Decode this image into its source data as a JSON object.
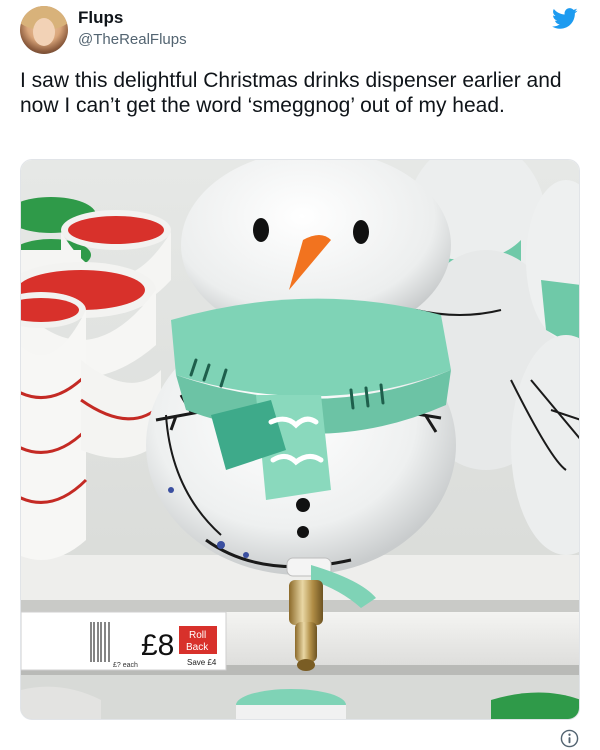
{
  "tweet": {
    "display_name": "Flups",
    "handle": "@TheRealFlups",
    "text": "I saw this delightful Christmas drinks dispenser earlier and now I can’t get the word ‘smeggnog’ out of my head.",
    "platform_icon": "twitter-bird-icon",
    "info_icon": "info-icon"
  },
  "photo": {
    "price_label": {
      "price": "£8",
      "each": "£? each",
      "badge_line1": "Roll",
      "badge_line2": "Back",
      "save": "Save £4"
    }
  },
  "colors": {
    "twitter_blue": "#1d9bf0",
    "scarf_mint": "#7fd3b6",
    "carrot": "#f2731f",
    "bowl_red": "#d8312b",
    "bowl_green": "#2f9a49"
  }
}
